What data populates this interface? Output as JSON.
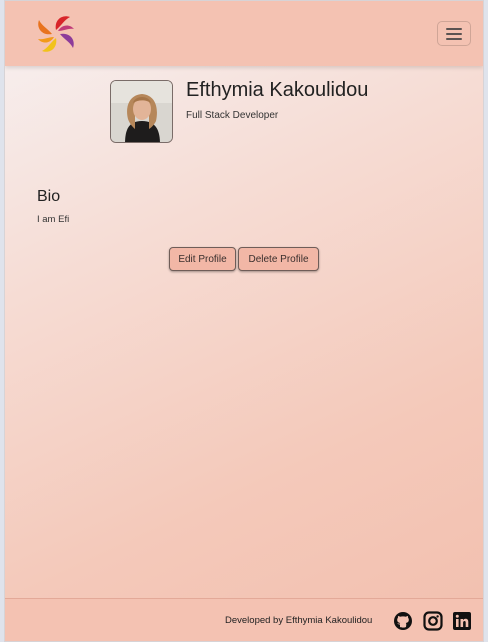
{
  "profile": {
    "name": "Efthymia Kakoulidou",
    "role": "Full Stack Developer"
  },
  "bio": {
    "heading": "Bio",
    "text": "I am Efi"
  },
  "actions": {
    "edit_label": "Edit Profile",
    "delete_label": "Delete Profile"
  },
  "footer": {
    "text": "Developed by Efthymia Kakoulidou",
    "social_icons": [
      "github-icon",
      "instagram-icon",
      "linkedin-icon"
    ]
  },
  "colors": {
    "navbar": "#f4c2b2",
    "button": "#f2b7a6",
    "gradient_start": "#f7f2f3",
    "gradient_end": "#f2bfae"
  }
}
